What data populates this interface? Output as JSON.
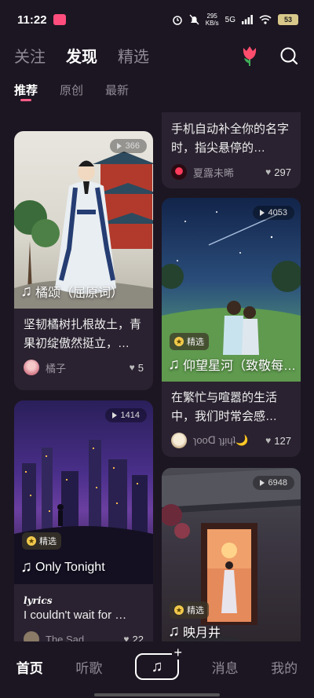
{
  "status": {
    "time": "11:22",
    "net_speed": "295",
    "net_unit": "KB/s",
    "network": "5G",
    "battery": "53"
  },
  "top_tabs": [
    "关注",
    "发现",
    "精选"
  ],
  "sub_tabs": [
    "推荐",
    "原创",
    "最新"
  ],
  "cards": {
    "c0": {
      "desc": "手机自动补全你的名字时，指尖悬停的…",
      "author": "夏露未晞",
      "likes": "297"
    },
    "c1": {
      "plays": "366",
      "title": "橘颂（屈原词）",
      "desc": "坚韧橘树扎根故土，青果初绽傲然挺立，…",
      "author": "橘子",
      "likes": "5"
    },
    "c2": {
      "plays": "4053",
      "badge": "精选",
      "title": "仰望星河（致敬每…",
      "desc": "在繁忙与喧嚣的生活中，我们时常会感…",
      "author": "ɿooᗡ ɿɟᴉɥʇ🌙",
      "likes": "127"
    },
    "c3": {
      "plays": "1414",
      "badge": "精选",
      "title": "Only Tonight",
      "lyric_label": "lyrics",
      "desc": "I couldn't wait for …",
      "author": "The Sad…",
      "likes": "22"
    },
    "c4": {
      "plays": "6948",
      "badge": "精选",
      "title": "映月井"
    }
  },
  "bottom_nav": [
    "首页",
    "听歌",
    "消息",
    "我的"
  ],
  "colors": {
    "accent": "#ff5c86",
    "background": "#1c1622",
    "card": "#2a2230"
  }
}
